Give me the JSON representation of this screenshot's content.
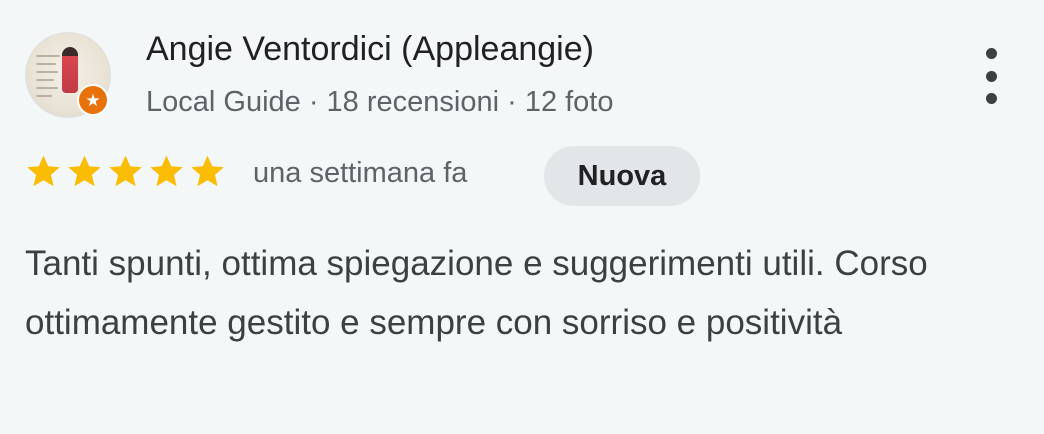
{
  "review": {
    "author": {
      "name": "Angie Ventordici (Appleangie)",
      "meta": "Local Guide · 18 recensioni · 12 foto",
      "badge": "local-guide-star-badge"
    },
    "rating": 5,
    "rating_max": 5,
    "time_ago": "una settimana fa",
    "tag": "Nuova",
    "text": "Tanti spunti, ottima spiegazione e suggerimenti utili. Corso ottimamente gestito e sempre con sorriso e positività"
  },
  "icons": {
    "star": "star-icon",
    "more": "more-vert-icon",
    "badge": "star-badge-icon"
  },
  "colors": {
    "star": "#fbbc04",
    "badge": "#e8710a",
    "pill_bg": "#e3e6e8",
    "background": "#f3f7f8"
  }
}
